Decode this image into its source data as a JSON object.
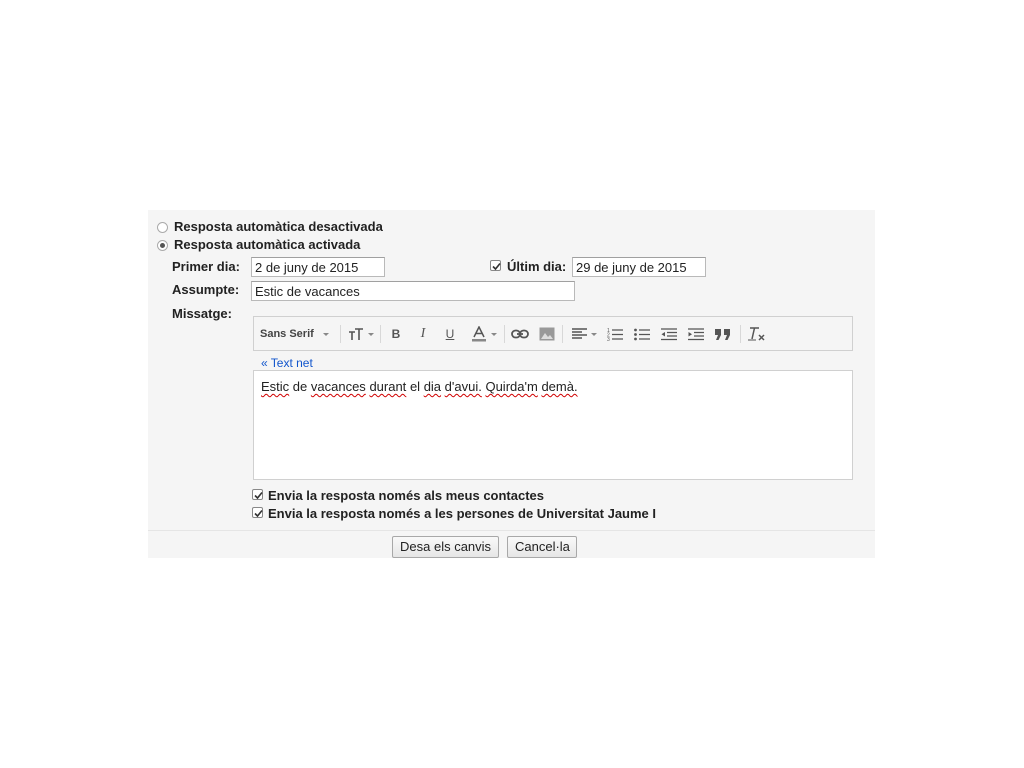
{
  "vacation": {
    "off_label": "Resposta automàtica desactivada",
    "on_label": "Resposta automàtica activada",
    "first_day_label": "Primer dia:",
    "first_day_value": "2 de juny de 2015",
    "last_day_label": "Últim dia:",
    "last_day_value": "29 de juny de 2015",
    "last_day_enabled": true,
    "subject_label": "Assumpte:",
    "subject_value": "Estic de vacances",
    "message_label": "Missatge:"
  },
  "toolbar": {
    "font_label": "Sans Serif",
    "icons": [
      "font-size-icon",
      "bold-icon",
      "italic-icon",
      "underline-icon",
      "text-color-icon",
      "link-icon",
      "image-icon",
      "align-icon",
      "numbered-list-icon",
      "bulleted-list-icon",
      "indent-less-icon",
      "indent-more-icon",
      "quote-icon",
      "remove-formatting-icon"
    ]
  },
  "editor": {
    "plain_text_link": "« Text net",
    "words": [
      "Estic",
      "de",
      "vacances",
      "durant",
      "el",
      "dia",
      "d'avui.",
      "Quirda'm",
      "demà."
    ]
  },
  "options": {
    "contacts_only_label": "Envia la resposta només als meus contactes",
    "contacts_only_checked": true,
    "domain_only_label": "Envia la resposta només a les persones de Universitat Jaume I",
    "domain_only_checked": true
  },
  "buttons": {
    "save_label": "Desa els canvis",
    "cancel_label": "Cancel·la"
  }
}
